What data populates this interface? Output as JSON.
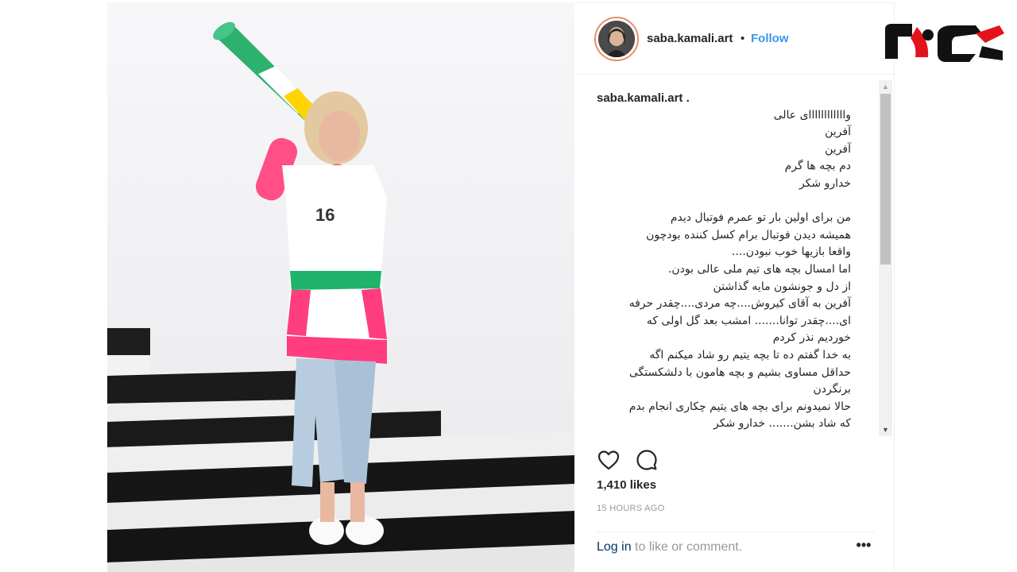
{
  "post": {
    "username": "saba.kamali.art",
    "separator": "•",
    "follow_label": "Follow",
    "caption_username": "saba.kamali.art .",
    "caption_lines_a": [
      "واااااااااااای عالی",
      "آفرین",
      "آفرین",
      "دم بچه ها گرم",
      "خدارو شکر"
    ],
    "caption_lines_b": [
      "من برای اولین بار تو عمرم فوتبال دیدم",
      "همیشه دیدن فوتبال برام کسل کننده بودچون",
      "واقعا بازیها خوب نبودن....",
      "اما امسال بچه های تیم ملی عالی بودن.",
      "از دل و جونشون مایه گذاشتن",
      "آفرین به آقای کیروش....چه مردی....چقدر حرفه",
      "ای....چقدر توانا....... امشب بعد گل اولی که",
      "خوردیم نذر کردم",
      "به خدا گفتم ده تا بچه یتیم رو شاد میکنم اگه",
      "حداقل مساوی بشیم و بچه هامون با دلشکستگی",
      "برنگردن",
      "حالا نمیدونم برای بچه های یتیم چکاری انجام بدم",
      "که شاد بشن....... خدارو شکر"
    ],
    "likes": "1,410 likes",
    "time": "15 HOURS AGO",
    "login_link": "Log in",
    "login_rest": " to like or comment.",
    "more_label": "•••"
  },
  "icons": {
    "like": "heart-icon",
    "comment": "comment-icon",
    "more": "more-options-icon",
    "scroll_up": "▲",
    "scroll_down": "▼"
  },
  "colors": {
    "follow": "#3897f0",
    "logo_red": "#e3131b",
    "logo_black": "#111111"
  }
}
